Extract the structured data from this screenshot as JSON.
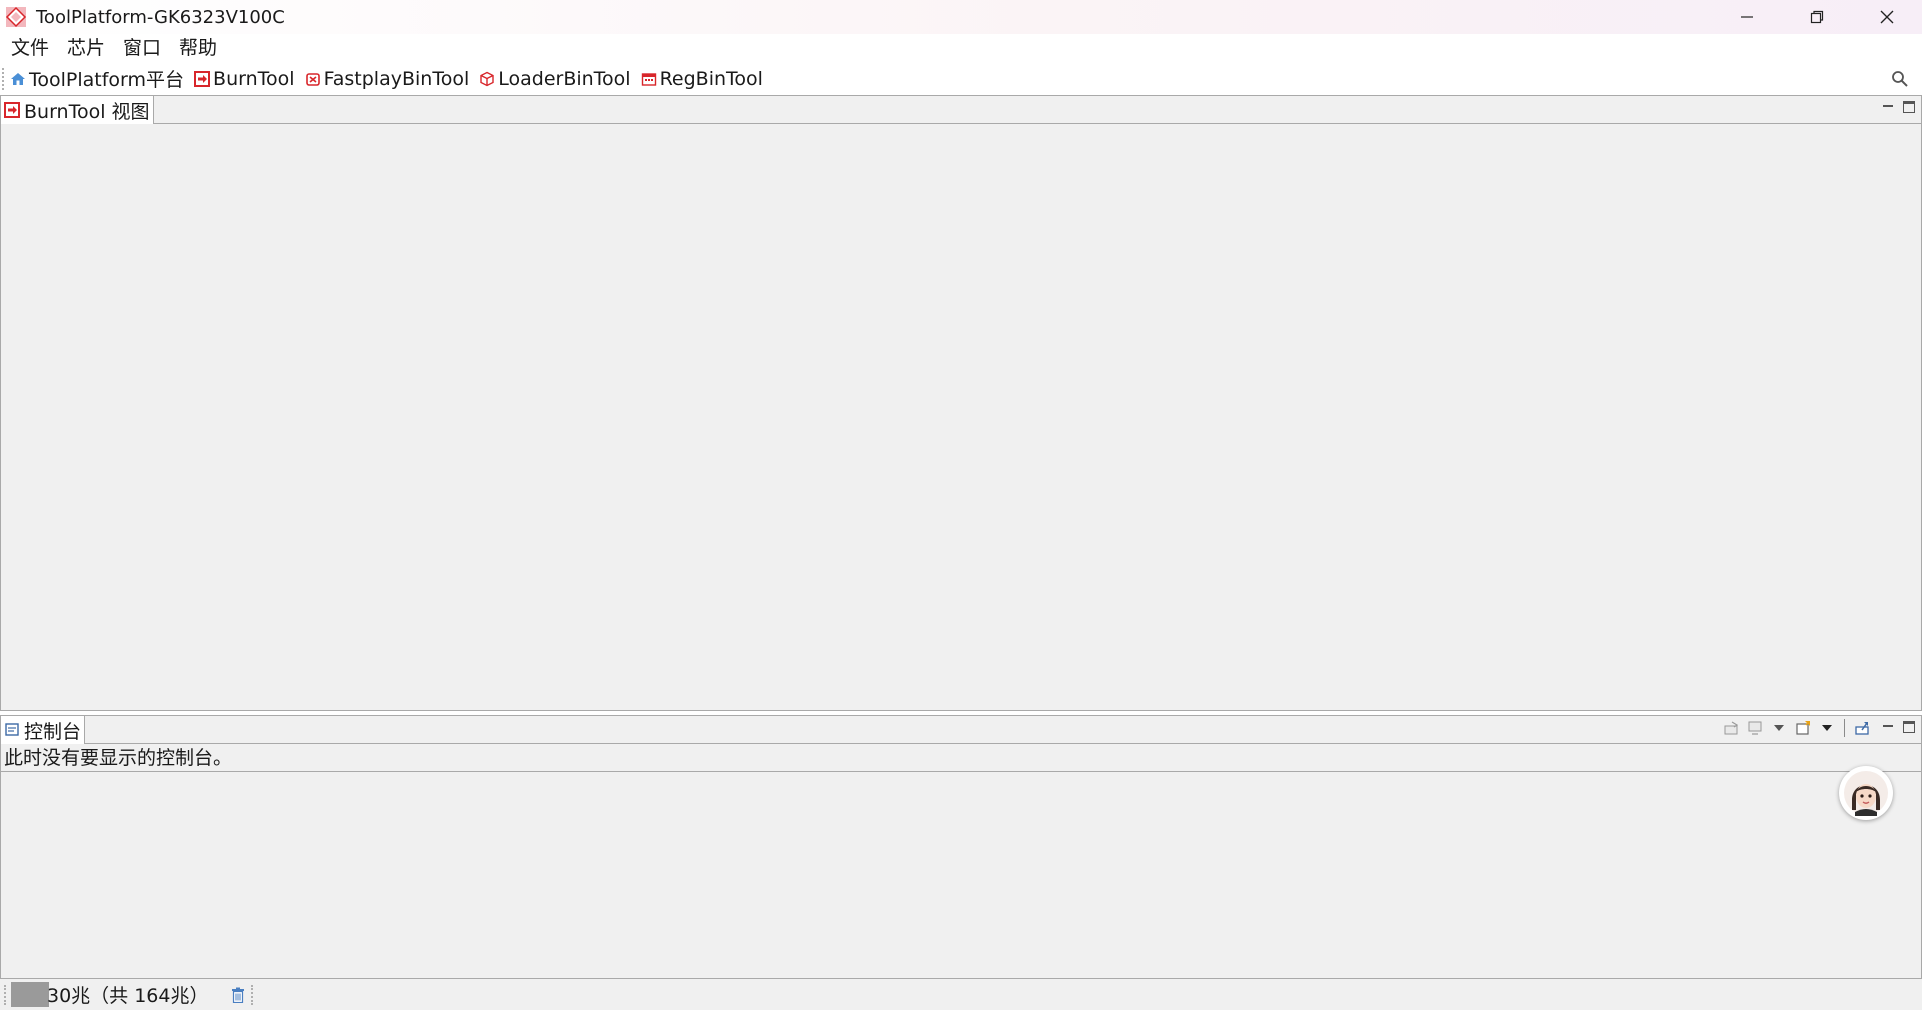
{
  "window": {
    "title": "ToolPlatform-GK6323V100C",
    "icon": "app-diamond-icon"
  },
  "menu": {
    "items": [
      {
        "label": "文件"
      },
      {
        "label": "芯片"
      },
      {
        "label": "窗口"
      },
      {
        "label": "帮助"
      }
    ]
  },
  "toolbar": {
    "perspectives": [
      {
        "label": "ToolPlatform平台",
        "icon": "home-icon"
      },
      {
        "label": "BurnTool",
        "icon": "burn-icon"
      },
      {
        "label": "FastplayBinTool",
        "icon": "fastplay-icon"
      },
      {
        "label": "LoaderBinTool",
        "icon": "cube-icon"
      },
      {
        "label": "RegBinTool",
        "icon": "register-icon"
      }
    ],
    "search_icon": "search-icon"
  },
  "top_view": {
    "tab_label": "BurnTool 视图",
    "tab_icon": "burn-icon"
  },
  "console_view": {
    "tab_label": "控制台",
    "tab_icon": "console-icon",
    "message": "此时没有要显示的控制台。"
  },
  "status": {
    "heap_text": "30兆（共 164兆）",
    "heap_used_fraction": 0.18,
    "gc_icon": "trash-icon"
  },
  "colors": {
    "accent_red": "#d8262b",
    "panel_bg": "#f0f0f0",
    "border": "#a9a9a9"
  }
}
